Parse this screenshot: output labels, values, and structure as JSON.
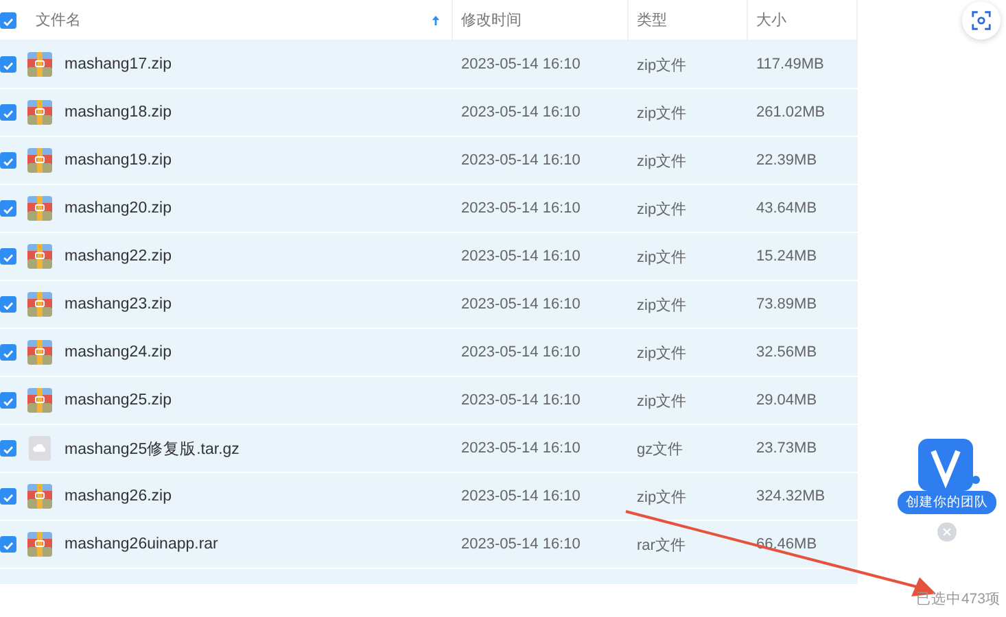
{
  "table": {
    "select_all": {
      "checked": true
    },
    "columns": [
      {
        "label": "文件名",
        "sorted": true
      },
      {
        "label": "修改时间",
        "sorted": false
      },
      {
        "label": "类型",
        "sorted": false
      },
      {
        "label": "大小",
        "sorted": false
      }
    ],
    "rows": [
      {
        "name": "mashang17.zip",
        "modified": "2023-05-14 16:10",
        "type": "zip文件",
        "size": "117.49MB",
        "kind": "archive",
        "selected": true
      },
      {
        "name": "mashang18.zip",
        "modified": "2023-05-14 16:10",
        "type": "zip文件",
        "size": "261.02MB",
        "kind": "archive",
        "selected": true
      },
      {
        "name": "mashang19.zip",
        "modified": "2023-05-14 16:10",
        "type": "zip文件",
        "size": "22.39MB",
        "kind": "archive",
        "selected": true
      },
      {
        "name": "mashang20.zip",
        "modified": "2023-05-14 16:10",
        "type": "zip文件",
        "size": "43.64MB",
        "kind": "archive",
        "selected": true
      },
      {
        "name": "mashang22.zip",
        "modified": "2023-05-14 16:10",
        "type": "zip文件",
        "size": "15.24MB",
        "kind": "archive",
        "selected": true
      },
      {
        "name": "mashang23.zip",
        "modified": "2023-05-14 16:10",
        "type": "zip文件",
        "size": "73.89MB",
        "kind": "archive",
        "selected": true
      },
      {
        "name": "mashang24.zip",
        "modified": "2023-05-14 16:10",
        "type": "zip文件",
        "size": "32.56MB",
        "kind": "archive",
        "selected": true
      },
      {
        "name": "mashang25.zip",
        "modified": "2023-05-14 16:10",
        "type": "zip文件",
        "size": "29.04MB",
        "kind": "archive",
        "selected": true
      },
      {
        "name": "mashang25修复版.tar.gz",
        "modified": "2023-05-14 16:10",
        "type": "gz文件",
        "size": "23.73MB",
        "kind": "generic",
        "selected": true
      },
      {
        "name": "mashang26.zip",
        "modified": "2023-05-14 16:10",
        "type": "zip文件",
        "size": "324.32MB",
        "kind": "archive",
        "selected": true
      },
      {
        "name": "mashang26uinapp.rar",
        "modified": "2023-05-14 16:10",
        "type": "rar文件",
        "size": "66.46MB",
        "kind": "archive",
        "selected": true
      }
    ]
  },
  "promo": {
    "label": "创建你的团队"
  },
  "status": "已选中473项"
}
